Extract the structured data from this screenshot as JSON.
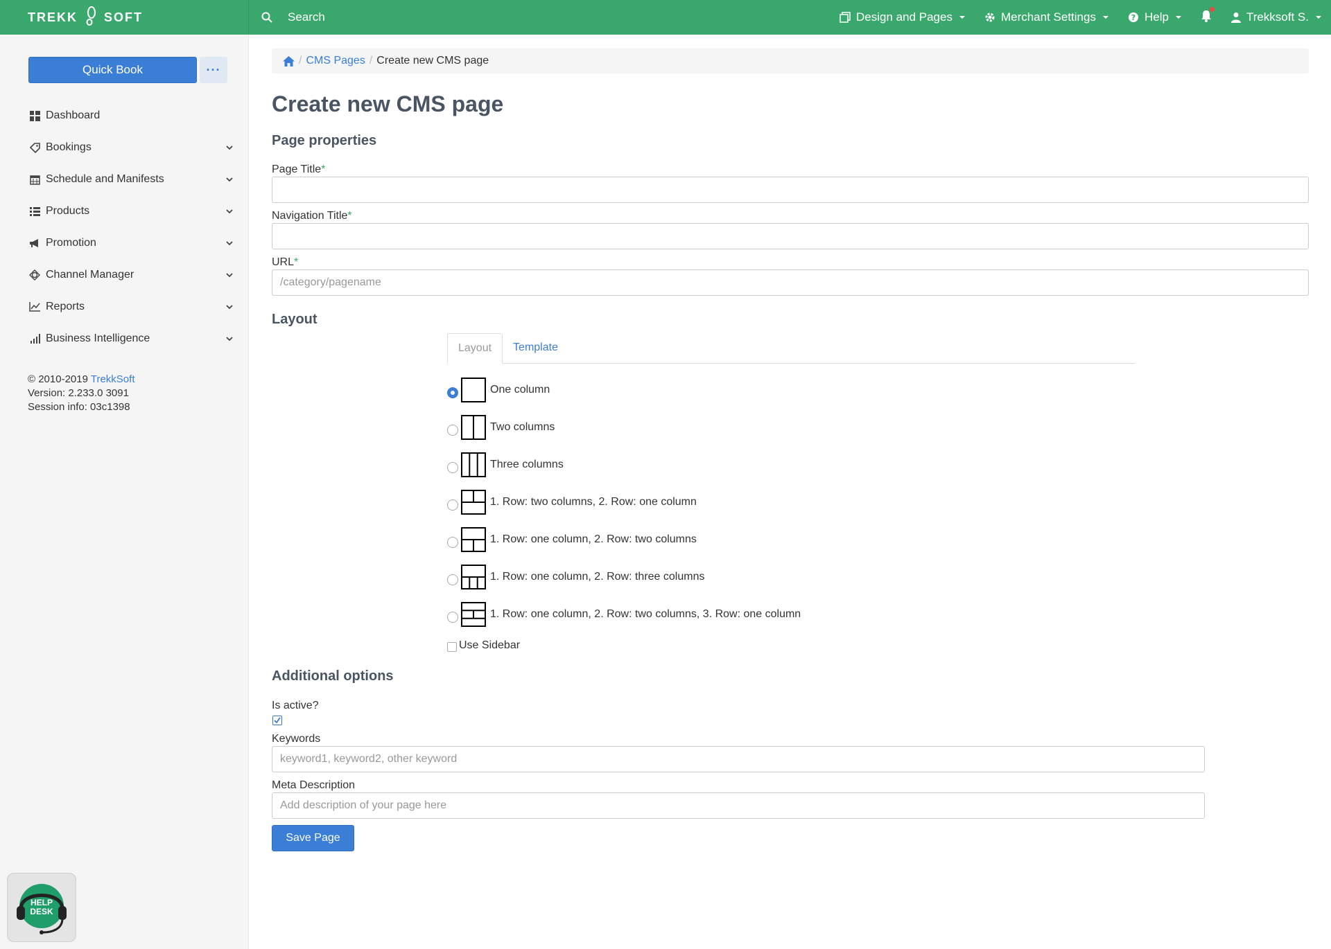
{
  "brand": {
    "left": "TREKK",
    "right": "SOFT"
  },
  "topbar": {
    "search_label": "Search",
    "design_pages": "Design and Pages",
    "merchant_settings": "Merchant Settings",
    "help": "Help",
    "user": "Trekksoft S."
  },
  "sidebar": {
    "quick_book": "Quick Book",
    "more": "···",
    "items": [
      {
        "label": "Dashboard",
        "icon": "dashboard-icon",
        "expandable": false
      },
      {
        "label": "Bookings",
        "icon": "tag-icon",
        "expandable": true
      },
      {
        "label": "Schedule and Manifests",
        "icon": "calendar-icon",
        "expandable": true
      },
      {
        "label": "Products",
        "icon": "list-icon",
        "expandable": true
      },
      {
        "label": "Promotion",
        "icon": "megaphone-icon",
        "expandable": true
      },
      {
        "label": "Channel Manager",
        "icon": "globe-icon",
        "expandable": true
      },
      {
        "label": "Reports",
        "icon": "line-chart-icon",
        "expandable": true
      },
      {
        "label": "Business Intelligence",
        "icon": "bar-chart-icon",
        "expandable": true
      }
    ],
    "footer": {
      "copyright_prefix": "© 2010-2019 ",
      "copyright_link": "TrekkSoft",
      "version": "Version: 2.233.0 3091",
      "session": "Session info: 03c1398"
    },
    "helpdesk_line1": "HELP",
    "helpdesk_line2": "DESK"
  },
  "breadcrumb": {
    "sep": "/",
    "cms_pages": "CMS Pages",
    "current": "Create new CMS page"
  },
  "page": {
    "title": "Create new CMS page",
    "properties_heading": "Page properties",
    "page_title_label": "Page Title",
    "nav_title_label": "Navigation Title",
    "url_label": "URL",
    "required_mark": "*",
    "page_title_value": "",
    "nav_title_value": "",
    "url_placeholder": "/category/pagename",
    "layout_heading": "Layout",
    "tabs": [
      "Layout",
      "Template"
    ],
    "layout_options": [
      {
        "label": "One column",
        "selected": true
      },
      {
        "label": "Two columns",
        "selected": false
      },
      {
        "label": "Three columns",
        "selected": false
      },
      {
        "label": "1. Row: two columns, 2. Row: one column",
        "selected": false
      },
      {
        "label": "1. Row: one column, 2. Row: two columns",
        "selected": false
      },
      {
        "label": "1. Row: one column, 2. Row: three columns",
        "selected": false
      },
      {
        "label": "1. Row: one column, 2. Row: two columns, 3. Row: one column",
        "selected": false
      }
    ],
    "use_sidebar_label": "Use Sidebar",
    "use_sidebar_checked": false,
    "additional_heading": "Additional options",
    "is_active_label": "Is active?",
    "is_active_checked": true,
    "keywords_label": "Keywords",
    "keywords_placeholder": "keyword1, keyword2, other keyword",
    "meta_label": "Meta Description",
    "meta_placeholder": "Add description of your page here",
    "save_label": "Save Page"
  },
  "colors": {
    "brand_green": "#3aa76d",
    "primary_blue": "#3a7ed6",
    "heading": "#4a5563"
  }
}
